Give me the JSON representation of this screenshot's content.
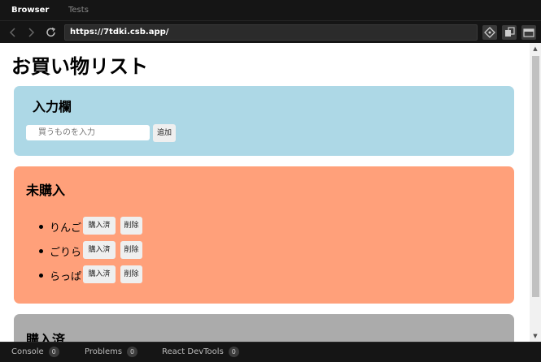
{
  "browser": {
    "tabs": [
      {
        "label": "Browser"
      },
      {
        "label": "Tests"
      }
    ],
    "url": "https://7tdki.csb.app/"
  },
  "page": {
    "title": "お買い物リスト",
    "input_section": {
      "heading": "入力欄",
      "placeholder": "買うものを入力",
      "add_label": "追加"
    },
    "pending_section": {
      "heading": "未購入",
      "items": [
        {
          "name": "りんご",
          "buy_label": "購入済",
          "delete_label": "削除"
        },
        {
          "name": "ごりら",
          "buy_label": "購入済",
          "delete_label": "削除"
        },
        {
          "name": "らっぱ",
          "buy_label": "購入済",
          "delete_label": "削除"
        }
      ]
    },
    "purchased_section": {
      "heading": "購入済"
    }
  },
  "statusbar": {
    "items": [
      {
        "label": "Console",
        "count": "0"
      },
      {
        "label": "Problems",
        "count": "0"
      },
      {
        "label": "React DevTools",
        "count": "0"
      }
    ]
  },
  "colors": {
    "input_bg": "#add8e6",
    "pending_bg": "#ffa07a",
    "purchased_bg": "#ababab"
  },
  "icons": [
    "back-icon",
    "forward-icon",
    "refresh-icon",
    "device-icon",
    "window-icon",
    "split-icon"
  ]
}
